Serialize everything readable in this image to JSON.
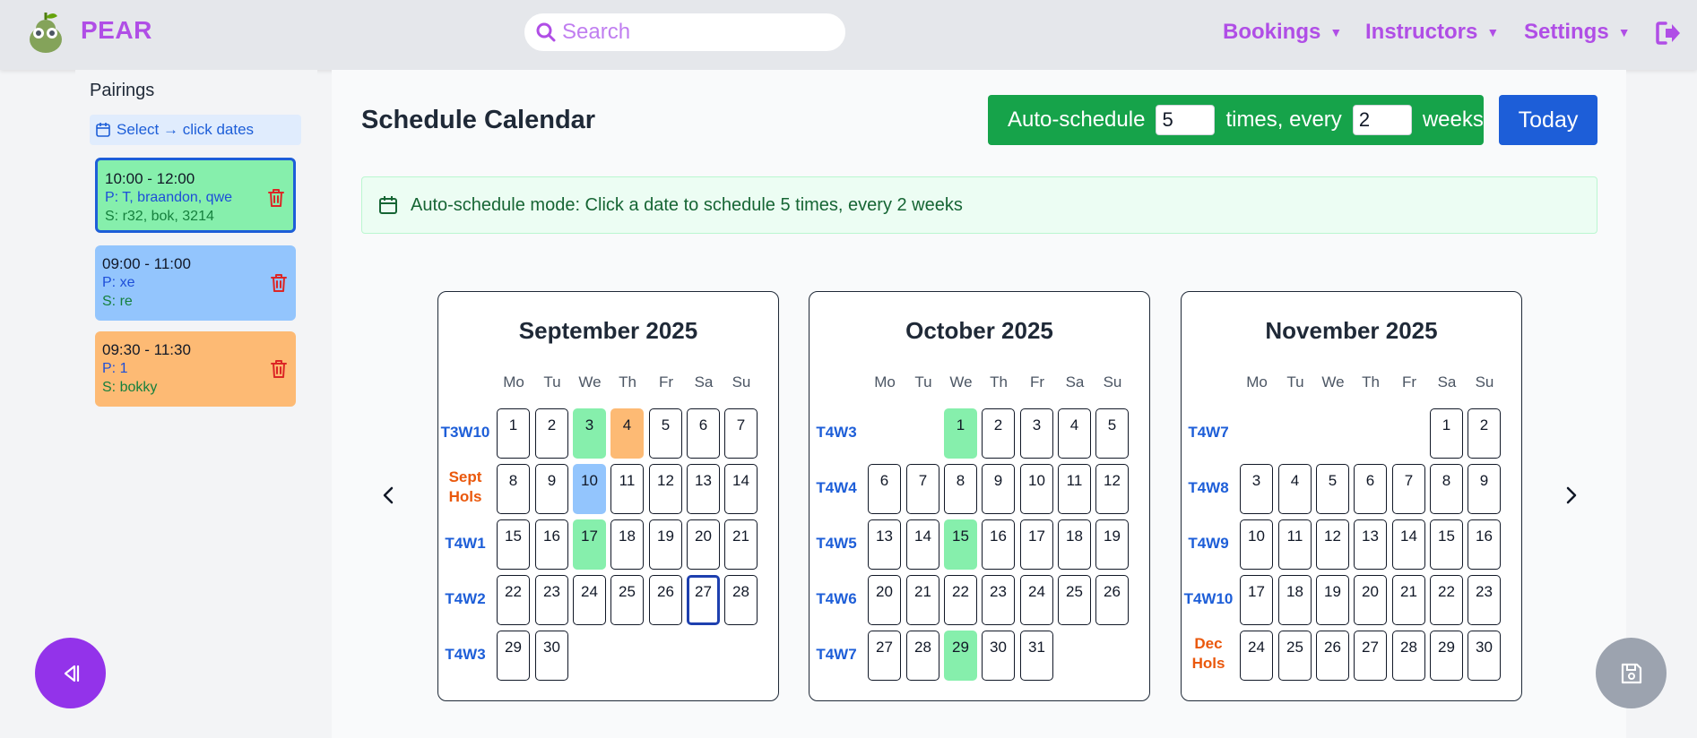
{
  "app": {
    "brand": "PEAR"
  },
  "search": {
    "placeholder": "Search"
  },
  "nav": {
    "bookings": "Bookings",
    "instructors": "Instructors",
    "settings": "Settings"
  },
  "sidebar": {
    "title": "Pairings",
    "select_label": "Select → click dates",
    "pairings": [
      {
        "time": "10:00 - 12:00",
        "p_prefix": "P:",
        "p_value": "T, braandon, qwe",
        "s_prefix": "S:",
        "s_value": "r32, bok, 3214",
        "color": "#86efac",
        "selected": true
      },
      {
        "time": "09:00 - 11:00",
        "p_prefix": "P:",
        "p_value": "xe",
        "s_prefix": "S:",
        "s_value": "re",
        "color": "#93c5fd",
        "selected": false
      },
      {
        "time": "09:30 - 11:30",
        "p_prefix": "P:",
        "p_value": "1",
        "s_prefix": "S:",
        "s_value": "bokky",
        "color": "#fdba74",
        "selected": false
      }
    ]
  },
  "main": {
    "title": "Schedule Calendar",
    "auto_schedule": {
      "label": "Auto-schedule",
      "times_value": "5",
      "times_label": "times, every",
      "weeks_value": "2",
      "weeks_label": "weeks"
    },
    "today_label": "Today",
    "banner": "Auto-schedule mode: Click a date to schedule 5 times, every 2 weeks"
  },
  "calendar": {
    "dow": [
      "Mo",
      "Tu",
      "We",
      "Th",
      "Fr",
      "Sa",
      "Su"
    ],
    "months": [
      {
        "title": "September 2025",
        "weeks": [
          {
            "label": [
              "T3W10"
            ],
            "hols": false,
            "days": [
              1,
              2,
              3,
              4,
              5,
              6,
              7
            ]
          },
          {
            "label": [
              "Sept",
              "Hols"
            ],
            "hols": true,
            "days": [
              8,
              9,
              10,
              11,
              12,
              13,
              14
            ]
          },
          {
            "label": [
              "T4W1"
            ],
            "hols": false,
            "days": [
              15,
              16,
              17,
              18,
              19,
              20,
              21
            ]
          },
          {
            "label": [
              "T4W2"
            ],
            "hols": false,
            "days": [
              22,
              23,
              24,
              25,
              26,
              27,
              28
            ]
          },
          {
            "label": [
              "T4W3"
            ],
            "hols": false,
            "days": [
              29,
              30,
              null,
              null,
              null,
              null,
              null
            ]
          }
        ],
        "highlights": {
          "3": "green",
          "4": "orange",
          "10": "blue",
          "17": "green"
        },
        "today": 27
      },
      {
        "title": "October 2025",
        "weeks": [
          {
            "label": [
              "T4W3"
            ],
            "hols": false,
            "days": [
              null,
              null,
              1,
              2,
              3,
              4,
              5
            ]
          },
          {
            "label": [
              "T4W4"
            ],
            "hols": false,
            "days": [
              6,
              7,
              8,
              9,
              10,
              11,
              12
            ]
          },
          {
            "label": [
              "T4W5"
            ],
            "hols": false,
            "days": [
              13,
              14,
              15,
              16,
              17,
              18,
              19
            ]
          },
          {
            "label": [
              "T4W6"
            ],
            "hols": false,
            "days": [
              20,
              21,
              22,
              23,
              24,
              25,
              26
            ]
          },
          {
            "label": [
              "T4W7"
            ],
            "hols": false,
            "days": [
              27,
              28,
              29,
              30,
              31,
              null,
              null
            ]
          }
        ],
        "highlights": {
          "1": "green",
          "15": "green",
          "29": "green"
        },
        "today": null
      },
      {
        "title": "November 2025",
        "weeks": [
          {
            "label": [
              "T4W7"
            ],
            "hols": false,
            "days": [
              null,
              null,
              null,
              null,
              null,
              1,
              2
            ]
          },
          {
            "label": [
              "T4W8"
            ],
            "hols": false,
            "days": [
              3,
              4,
              5,
              6,
              7,
              8,
              9
            ]
          },
          {
            "label": [
              "T4W9"
            ],
            "hols": false,
            "days": [
              10,
              11,
              12,
              13,
              14,
              15,
              16
            ]
          },
          {
            "label": [
              "T4W10"
            ],
            "hols": false,
            "days": [
              17,
              18,
              19,
              20,
              21,
              22,
              23
            ]
          },
          {
            "label": [
              "Dec",
              "Hols"
            ],
            "hols": true,
            "days": [
              24,
              25,
              26,
              27,
              28,
              29,
              30
            ]
          }
        ],
        "highlights": {},
        "today": null
      }
    ]
  },
  "colors": {
    "brand": "#b04ee6",
    "primary": "#1d5ed8",
    "success": "#16a34a",
    "holiday": "#ea580c"
  }
}
